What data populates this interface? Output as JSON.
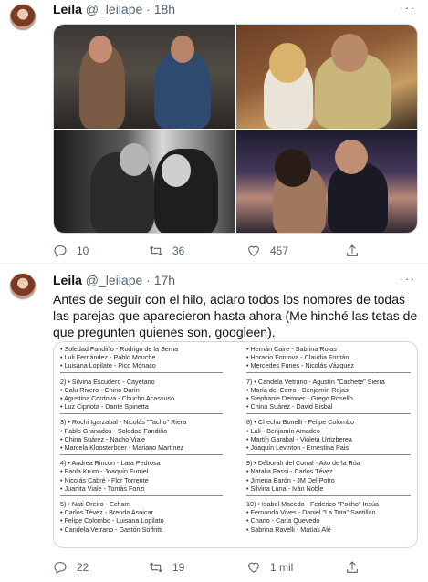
{
  "tweet1": {
    "name": "Leila",
    "handle": "@_leilape",
    "separator": "·",
    "time": "18h",
    "menu": "···",
    "replies": "10",
    "retweets": "36",
    "likes": "457"
  },
  "tweet2": {
    "name": "Leila",
    "handle": "@_leilape",
    "separator": "·",
    "time": "17h",
    "menu": "···",
    "text": "Antes de seguir con el hilo, aclaro todos los nombres de todas las parejas que aparecieron hasta ahora (Me hinché las tetas de que pregunten quienes son, googleen).",
    "replies": "22",
    "retweets": "19",
    "likes": "1 mil"
  },
  "list_left": [
    "• Soledad Fandiño - Rodrigo de la Serna",
    "• Luli Fernández - Pablo Mouche",
    "• Luisana Lopilato - Pico Mónaco",
    "2) • Silvina Escudero - Cayetano",
    "• Calu Rivero - Chino Darín",
    "• Agustina Cordova - Chucho Acassuso",
    "• Luz Cipriota - Dante Spinetta",
    "3) • Rochi Igarzabal - Nicolás \"Tacho\" Riera",
    "• Pablo Granados - Soledad Fandiño",
    "• China Suárez - Nacho Viale",
    "• Marcela Kloosterboer - Mariano Martínez",
    "4) • Andrea Rincón - Lara Pedrosa",
    "• Paola Krum - Joaquín Furriel",
    "• Nicolás Cabré - Flor Torrente",
    "• Juanita Viale - Tomás Fonzi",
    "5) • Nati Oreiro - Echarri",
    "• Carlos Tévez - Brenda Asnicar",
    "• Felipe Colombo - Luisana Lopilato",
    "• Candela Vetrano - Gastón Soffritti"
  ],
  "list_right": [
    "• Hernán Caire - Sabrina Rojas",
    "• Horacio Fontova - Claudia Fontán",
    "• Mercedes Funes - Nicolás Vázquez",
    "7) • Candela Vetrano - Agustín \"Cachete\" Sierra",
    "• María del Cerro - Benjamín Rojas",
    "• Stephanie Demner - Grego Rosello",
    "• China Suárez - David Bisbal",
    "8) • Chechu Bonelli - Felipe Colombo",
    "• Lali - Benjamín Amadeo",
    "• Martín Garabal - Violeta Urtizberea",
    "• Joaquín Levinton - Ernestina Pais",
    "9) • Déborah del Corral - Aito de la Rúa",
    "• Natalia Fassi - Carlos Tévez",
    "• Jimena Barón - JM Del Potro",
    "• Silvina Luna - Iván Noble",
    "10) • Isabel Macedo - Federico \"Pocho\" Insúa",
    "• Fernanda Vives - Daniel \"La Tota\" Santillan",
    "• Chano - Carla Quevedo",
    "• Sabrina Ravelli - Matías Alé"
  ]
}
